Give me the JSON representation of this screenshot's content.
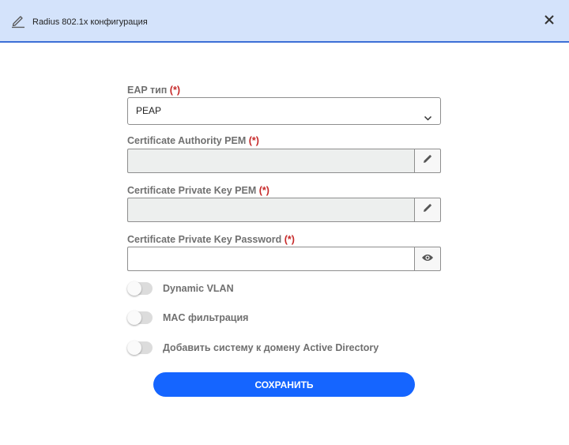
{
  "dialog": {
    "title": "Radius 802.1x конфигурация",
    "edit_icon": "pencil-icon",
    "close_icon": "close-icon"
  },
  "form": {
    "eap_type": {
      "label": "EAP тип",
      "required_mark": "(*)",
      "value": "PEAP"
    },
    "ca_pem": {
      "label": "Certificate Authority PEM",
      "required_mark": "(*)",
      "value": "",
      "button_icon": "pencil-icon"
    },
    "private_key_pem": {
      "label": "Certificate Private Key PEM",
      "required_mark": "(*)",
      "value": "",
      "button_icon": "pencil-icon"
    },
    "private_key_password": {
      "label": "Certificate Private Key Password",
      "required_mark": "(*)",
      "value": "",
      "button_icon": "eye-icon"
    },
    "toggles": [
      {
        "label": "Dynamic VLAN",
        "checked": false
      },
      {
        "label": "MAC фильтрация",
        "checked": false
      },
      {
        "label": "Добавить систему к домену Active Directory",
        "checked": false
      }
    ],
    "save_label": "СОХРАНИТЬ"
  },
  "colors": {
    "header_bg": "#d4e3fb",
    "header_border": "#3d6fd6",
    "accent": "#1565ff",
    "required": "#c62828",
    "disabled_field": "#edefee"
  }
}
